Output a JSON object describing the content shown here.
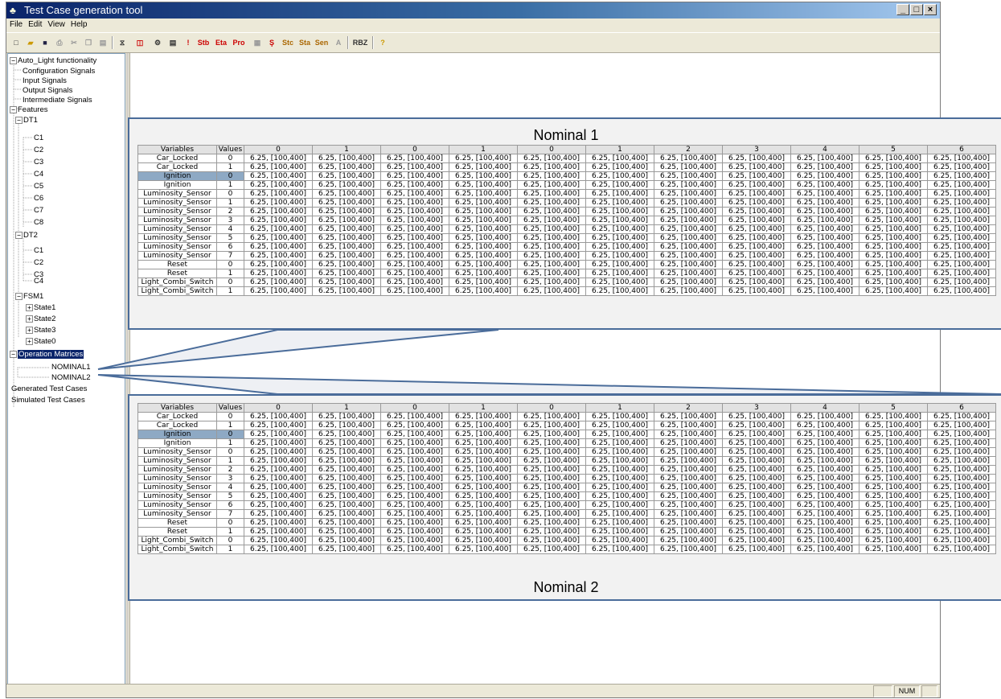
{
  "window": {
    "title": "Test Case generation tool",
    "controls": [
      "_",
      "□",
      "×"
    ]
  },
  "menu": [
    "File",
    "Edit",
    "View",
    "Help"
  ],
  "toolbar": {
    "labels": [
      "Stb",
      "Eta",
      "Pro",
      "Stc",
      "Sta",
      "Sen",
      "RBZ"
    ]
  },
  "tree": {
    "root": "Auto_Light functionality",
    "config": "Configuration Signals",
    "input": "Input Signals",
    "output": "Output Signals",
    "intermediate": "Intermediate Signals",
    "features": "Features",
    "dt1": "DT1",
    "dt1_items": [
      "C1",
      "C2",
      "C3",
      "C4",
      "C5",
      "C6",
      "C7",
      "C8"
    ],
    "dt2": "DT2",
    "dt2_items": [
      "C1",
      "C2",
      "C3",
      "C4"
    ],
    "fsm": "FSM1",
    "states": [
      "State1",
      "State2",
      "State3",
      "State0"
    ],
    "op_matrices": "Operation Matrices",
    "nominal1": "NOMINAL1",
    "nominal2": "NOMINAL2",
    "generated": "Generated Test Cases",
    "simulated": "Simulated Test Cases"
  },
  "status": {
    "num": "NUM"
  },
  "matrix": {
    "header_variables": "Variables",
    "header_values": "Values",
    "columns": [
      "0",
      "1",
      "0",
      "1",
      "0",
      "1",
      "2",
      "3",
      "4",
      "5",
      "6"
    ],
    "cell_value": "6.25, [100,400]",
    "rows": [
      [
        "Car_Locked",
        "0"
      ],
      [
        "Car_Locked",
        "1"
      ],
      [
        "Ignition",
        "0"
      ],
      [
        "Ignition",
        "1"
      ],
      [
        "Luminosity_Sensor",
        "0"
      ],
      [
        "Luminosity_Sensor",
        "1"
      ],
      [
        "Luminosity_Sensor",
        "2"
      ],
      [
        "Luminosity_Sensor",
        "3"
      ],
      [
        "Luminosity_Sensor",
        "4"
      ],
      [
        "Luminosity_Sensor",
        "5"
      ],
      [
        "Luminosity_Sensor",
        "6"
      ],
      [
        "Luminosity_Sensor",
        "7"
      ],
      [
        "Reset",
        "0"
      ],
      [
        "Reset",
        "1"
      ],
      [
        "Light_Combi_Switch",
        "0"
      ],
      [
        "Light_Combi_Switch",
        "1"
      ]
    ],
    "highlight_row": 2
  },
  "callouts": [
    {
      "title": "Nominal 1"
    },
    {
      "title": "Nominal 2"
    }
  ],
  "colors": {
    "selection": "#0a246a",
    "highlight": "#8ea9c4",
    "callout_border": "#4a6c9a"
  }
}
